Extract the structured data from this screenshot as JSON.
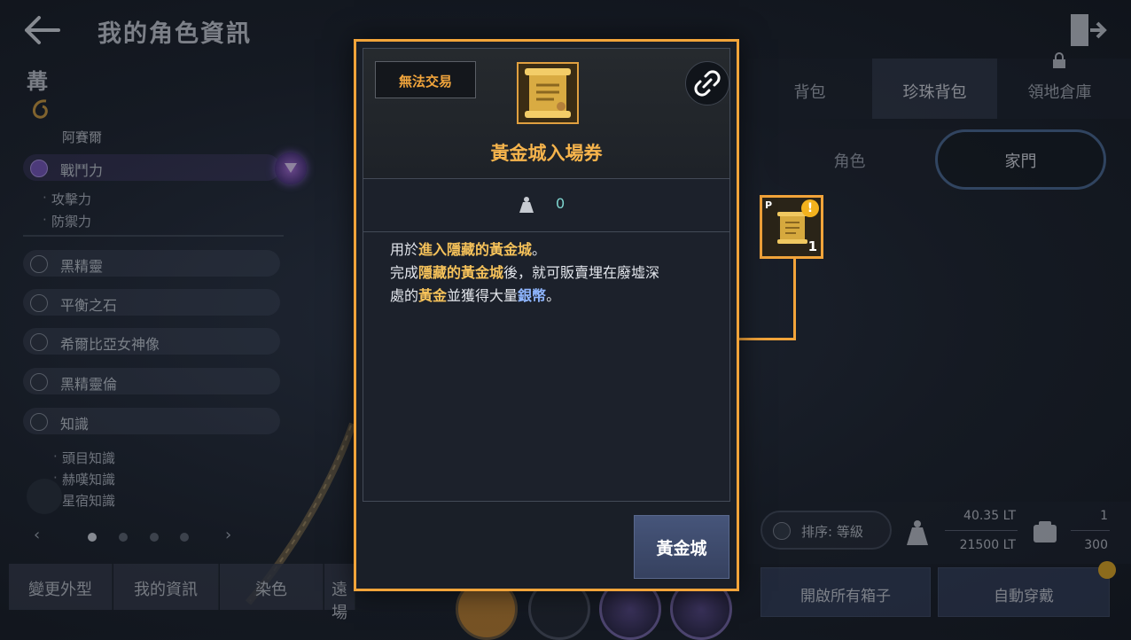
{
  "header": {
    "title": "我的角色資訊"
  },
  "left_panel": {
    "rank_glyph": "冓",
    "family_name": "阿賽爾",
    "combat_power_label": "戰鬥力",
    "combat_stats": [
      "攻擊力",
      "防禦力"
    ],
    "categories": [
      "黑精靈",
      "平衡之石",
      "希爾比亞女神像",
      "黑精靈倫"
    ],
    "knowledge_label": "知識",
    "knowledge_items": [
      "頭目知識",
      "赫嘆知識",
      "星宿知識"
    ],
    "pager": {
      "total": 4,
      "active": 0,
      "prev": "‹",
      "next": "›"
    }
  },
  "bottom_tabs": [
    "變更外型",
    "我的資訊",
    "染色",
    "遠場"
  ],
  "right_panel": {
    "tabs": [
      {
        "label": "背包",
        "active": false
      },
      {
        "label": "珍珠背包",
        "active": true
      },
      {
        "label": "領地倉庫",
        "active": false,
        "locked": true
      }
    ],
    "segment": [
      {
        "label": "角色",
        "active": false
      },
      {
        "label": "家門",
        "active": true
      }
    ],
    "slot": {
      "badge": "P",
      "warning": "!",
      "quantity": "1",
      "icon": "golden-scroll-icon"
    },
    "sort_label": "排序: 等級",
    "weight": {
      "current": "40.35 LT",
      "max": "21500 LT"
    },
    "slots": {
      "used": "1",
      "max": "300"
    },
    "open_boxes_label": "開啟所有箱子",
    "auto_equip_label": "自動穿戴"
  },
  "popup": {
    "trade_label": "無法交易",
    "item_name": "黃金城入場券",
    "weight_value": "0",
    "description": {
      "l1_a": "用於",
      "l1_b": "進入隱藏的黃金城",
      "l1_c": "。",
      "l2_a": "完成",
      "l2_b": "隱藏的黃金城",
      "l2_c": "後，就可販賣埋在廢墟深",
      "l3_a": "處的",
      "l3_b": "黃金",
      "l3_c": "並獲得大量",
      "l3_d": "銀幣",
      "l3_e": "。"
    },
    "action_label": "黃金城"
  },
  "colors": {
    "accent_orange": "#f2a43a",
    "title_gold": "#f6b44c",
    "highlight_gold": "#f6c25a",
    "highlight_blue": "#8fb6ff",
    "weight_cyan": "#7fd6d0"
  }
}
